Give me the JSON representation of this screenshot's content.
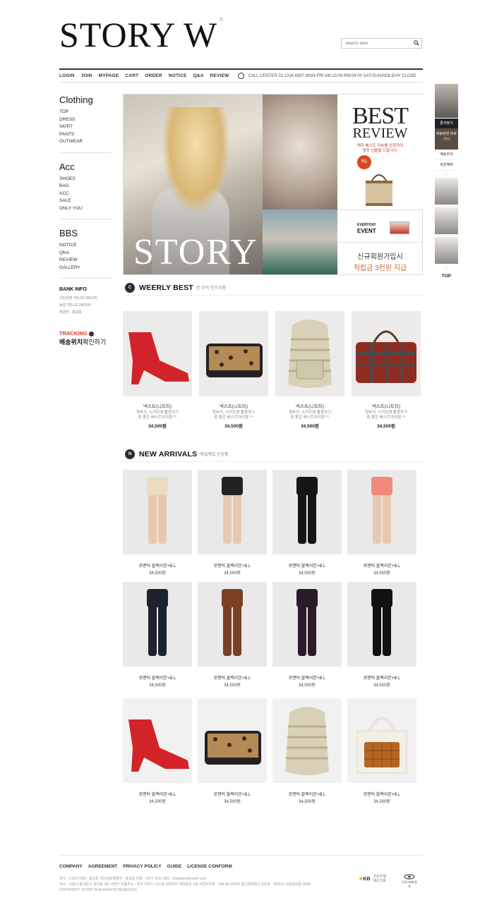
{
  "brand": {
    "logo": "STORY W",
    "reg": "®"
  },
  "search": {
    "placeholder": "Search Item"
  },
  "topnav": {
    "links": [
      "LOGIN",
      "JOIN",
      "MYPAGE",
      "CART",
      "ORDER",
      "NOTICE",
      "Q&A",
      "REVIEW"
    ],
    "callcenter": "CALL CENTER 02.1234.6987  MON-FRI AM:10:00-PM:04:00  SAT/SUN/HOLIDAY CLOSE"
  },
  "sidebar": {
    "sections": [
      {
        "title": "Clothing",
        "items": [
          "TOP",
          "DRESS",
          "SKIRT",
          "PANTS",
          "OUTWEAR"
        ]
      },
      {
        "title": "Acc",
        "items": [
          "SHOES",
          "BAG",
          "ACC",
          "SALE",
          "ONLY YOU"
        ]
      },
      {
        "title": "BBS",
        "items": [
          "NOTICE",
          "QNA",
          "REVIEW",
          "GALLERY"
        ]
      }
    ],
    "bank": {
      "title": "BANK INFO",
      "lines": [
        "국민은행   705-02-266105",
        "농협        705-02-266105",
        "예금주 : 홍길동"
      ]
    },
    "tracking": {
      "title": "TRACKING",
      "sub_bold": "배송위치",
      "sub_rest": "확인하기"
    }
  },
  "hero": {
    "story": "STORY",
    "best_title1": "BEST",
    "best_title2": "REVIEW",
    "best_desc": "매주 베스트 리뷰를 선정하여\n영정 선물을 드립니다.",
    "badge": "택1",
    "event_small": "EVERYDAY",
    "event_big": "EVENT",
    "join_line1": "신규회원가입시",
    "join_line2": "적립금 3천원 지급"
  },
  "quickbar": {
    "fav": "즐겨찾기",
    "mobile": "바탕화면 바로가기",
    "links": [
      "배송안내",
      "회원혜택"
    ],
    "top": "TOP"
  },
  "weekly": {
    "icon": "C",
    "title": "WEERLY BEST",
    "subtitle": "한 주의 인기상품",
    "items": [
      {
        "name": "넥스트(니트티)",
        "desc": "청바지, 스커트에 활용하기\n참 좋은 베스트아이템 ^^",
        "price": "34,500원"
      },
      {
        "name": "넥스트(니트티)",
        "desc": "청바지, 스커트에 활용하기\n참 좋은 베스트아이템 ^^",
        "price": "34,500원"
      },
      {
        "name": "넥스트(니트티)",
        "desc": "청바지, 스커트에 활용하기\n참 좋은 베스트아이템 ^^",
        "price": "34,500원"
      },
      {
        "name": "넥스트(니트티)",
        "desc": "청바지, 스커트에 활용하기\n참 좋은 베스트아이템 ^^",
        "price": "34,500원"
      }
    ]
  },
  "new_arrivals": {
    "icon": "N",
    "title": "NEW ARRIVALS",
    "subtitle": "매일매일 신상품",
    "item_name": "로맨틱 블랙리본+B.L",
    "item_price": "34,500원"
  },
  "footer": {
    "links": [
      "COMPANY",
      "AGREEMENT",
      "PRIVACY POLICY",
      "GUIDE",
      "LICENSE CONFORM"
    ],
    "info1": "회사 : 스토리   대표 : 홍길동  개인정보책임자 : 홍길동   전화 : 1577-1151   메일 : shopskin@naver.com",
    "info2": "주소 : 서울시 동대문구 장안동 367-2번지   반품주소 : 경기 구리시 사노동 330번지 대한통운 1팀    사업자번호 : 204-86-25024   통신판매업신고번호 : 제3011-서동동대문-0045",
    "copyright": "COPYRIGHT STORY W All RIGHTS RESERVED.",
    "kb_logo": "KB",
    "kb_text": "국민은행\n에스크로",
    "kfb_text": "공정거래위원회"
  }
}
